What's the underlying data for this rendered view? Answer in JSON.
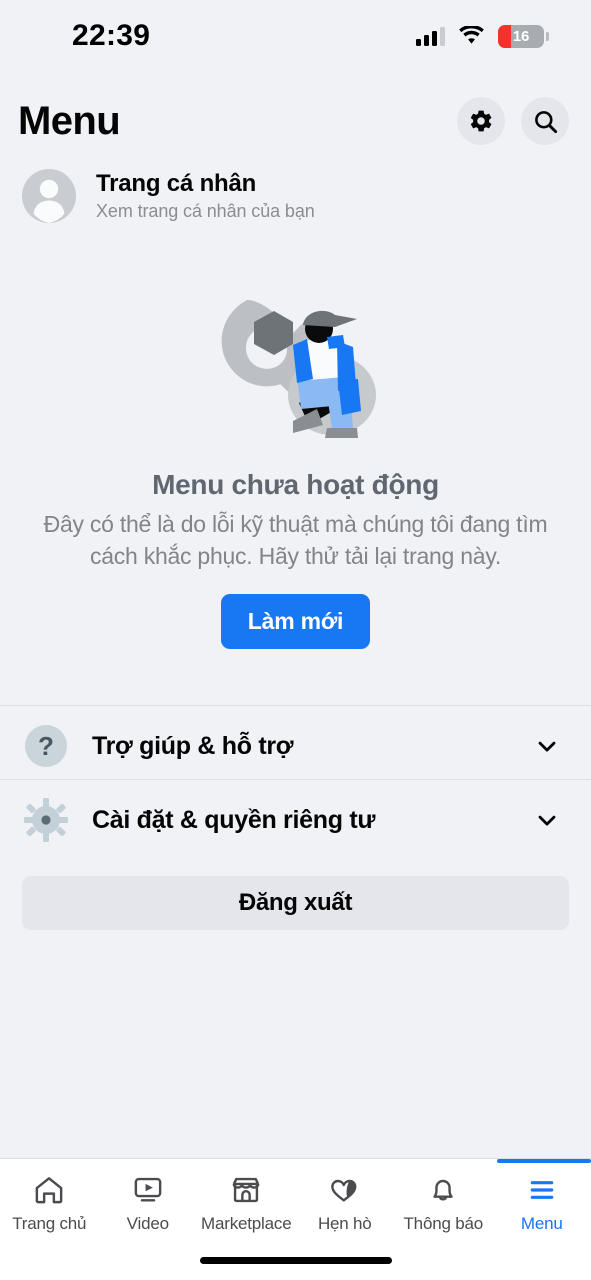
{
  "status_bar": {
    "time": "22:39",
    "battery_percent": "16",
    "signal_icon": "cellular-signal-icon",
    "wifi_icon": "wifi-icon",
    "battery_icon": "battery-low-icon"
  },
  "header": {
    "title": "Menu",
    "settings_icon": "gear-icon",
    "search_icon": "search-icon"
  },
  "profile": {
    "name": "Trang cá nhân",
    "subtitle": "Xem trang cá nhân của bạn",
    "avatar_icon": "default-avatar-icon"
  },
  "error": {
    "illustration_icon": "wrench-worker-illustration",
    "title": "Menu chưa hoạt động",
    "description": "Đây có thể là do lỗi kỹ thuật mà chúng tôi đang tìm cách khắc phục. Hãy thử tải lại trang này.",
    "refresh_label": "Làm mới"
  },
  "menu_rows": [
    {
      "label": "Trợ giúp & hỗ trợ",
      "icon": "help-question-icon",
      "chevron": "chevron-down-icon"
    },
    {
      "label": "Cài đặt & quyền riêng tư",
      "icon": "settings-gear-icon",
      "chevron": "chevron-down-icon"
    }
  ],
  "logout": {
    "label": "Đăng xuất"
  },
  "bottom_nav": {
    "items": [
      {
        "label": "Trang chủ",
        "icon": "home-icon",
        "active": false
      },
      {
        "label": "Video",
        "icon": "video-icon",
        "active": false
      },
      {
        "label": "Marketplace",
        "icon": "marketplace-icon",
        "active": false
      },
      {
        "label": "Hẹn hò",
        "icon": "dating-hearts-icon",
        "active": false
      },
      {
        "label": "Thông báo",
        "icon": "bell-icon",
        "active": false
      },
      {
        "label": "Menu",
        "icon": "hamburger-icon",
        "active": true
      }
    ]
  },
  "colors": {
    "background": "#F0F2F5",
    "accent_blue": "#1877F2",
    "text_primary": "#050505",
    "text_secondary": "#8A8D91",
    "button_gray": "#E4E6EB"
  }
}
